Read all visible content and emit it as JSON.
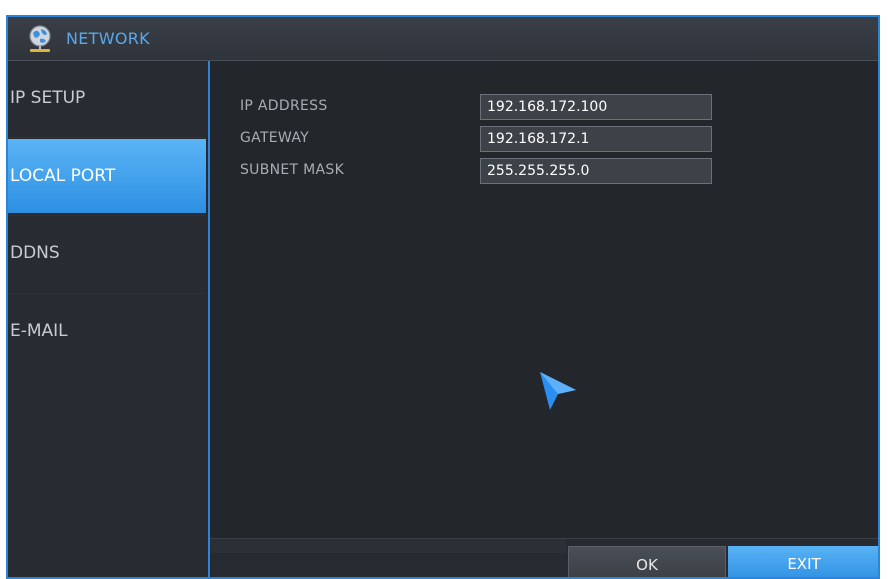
{
  "window": {
    "title": "NETWORK",
    "title_icon": "globe-network-icon",
    "accent_color": "#2b86d9"
  },
  "sidebar": {
    "items": [
      {
        "label": "IP SETUP",
        "active": false
      },
      {
        "label": "LOCAL PORT",
        "active": true
      },
      {
        "label": "DDNS",
        "active": false
      },
      {
        "label": "E-MAIL",
        "active": false
      }
    ]
  },
  "form": {
    "ip_address": {
      "label": "IP ADDRESS",
      "value": "192.168.172.100"
    },
    "gateway": {
      "label": "GATEWAY",
      "value": "192.168.172.1"
    },
    "subnet_mask": {
      "label": "SUBNET MASK",
      "value": "255.255.255.0"
    }
  },
  "footer": {
    "ok_label": "OK",
    "exit_label": "EXIT"
  },
  "cursor": {
    "icon": "mouse-pointer-icon",
    "color": "#2a8ff0"
  }
}
